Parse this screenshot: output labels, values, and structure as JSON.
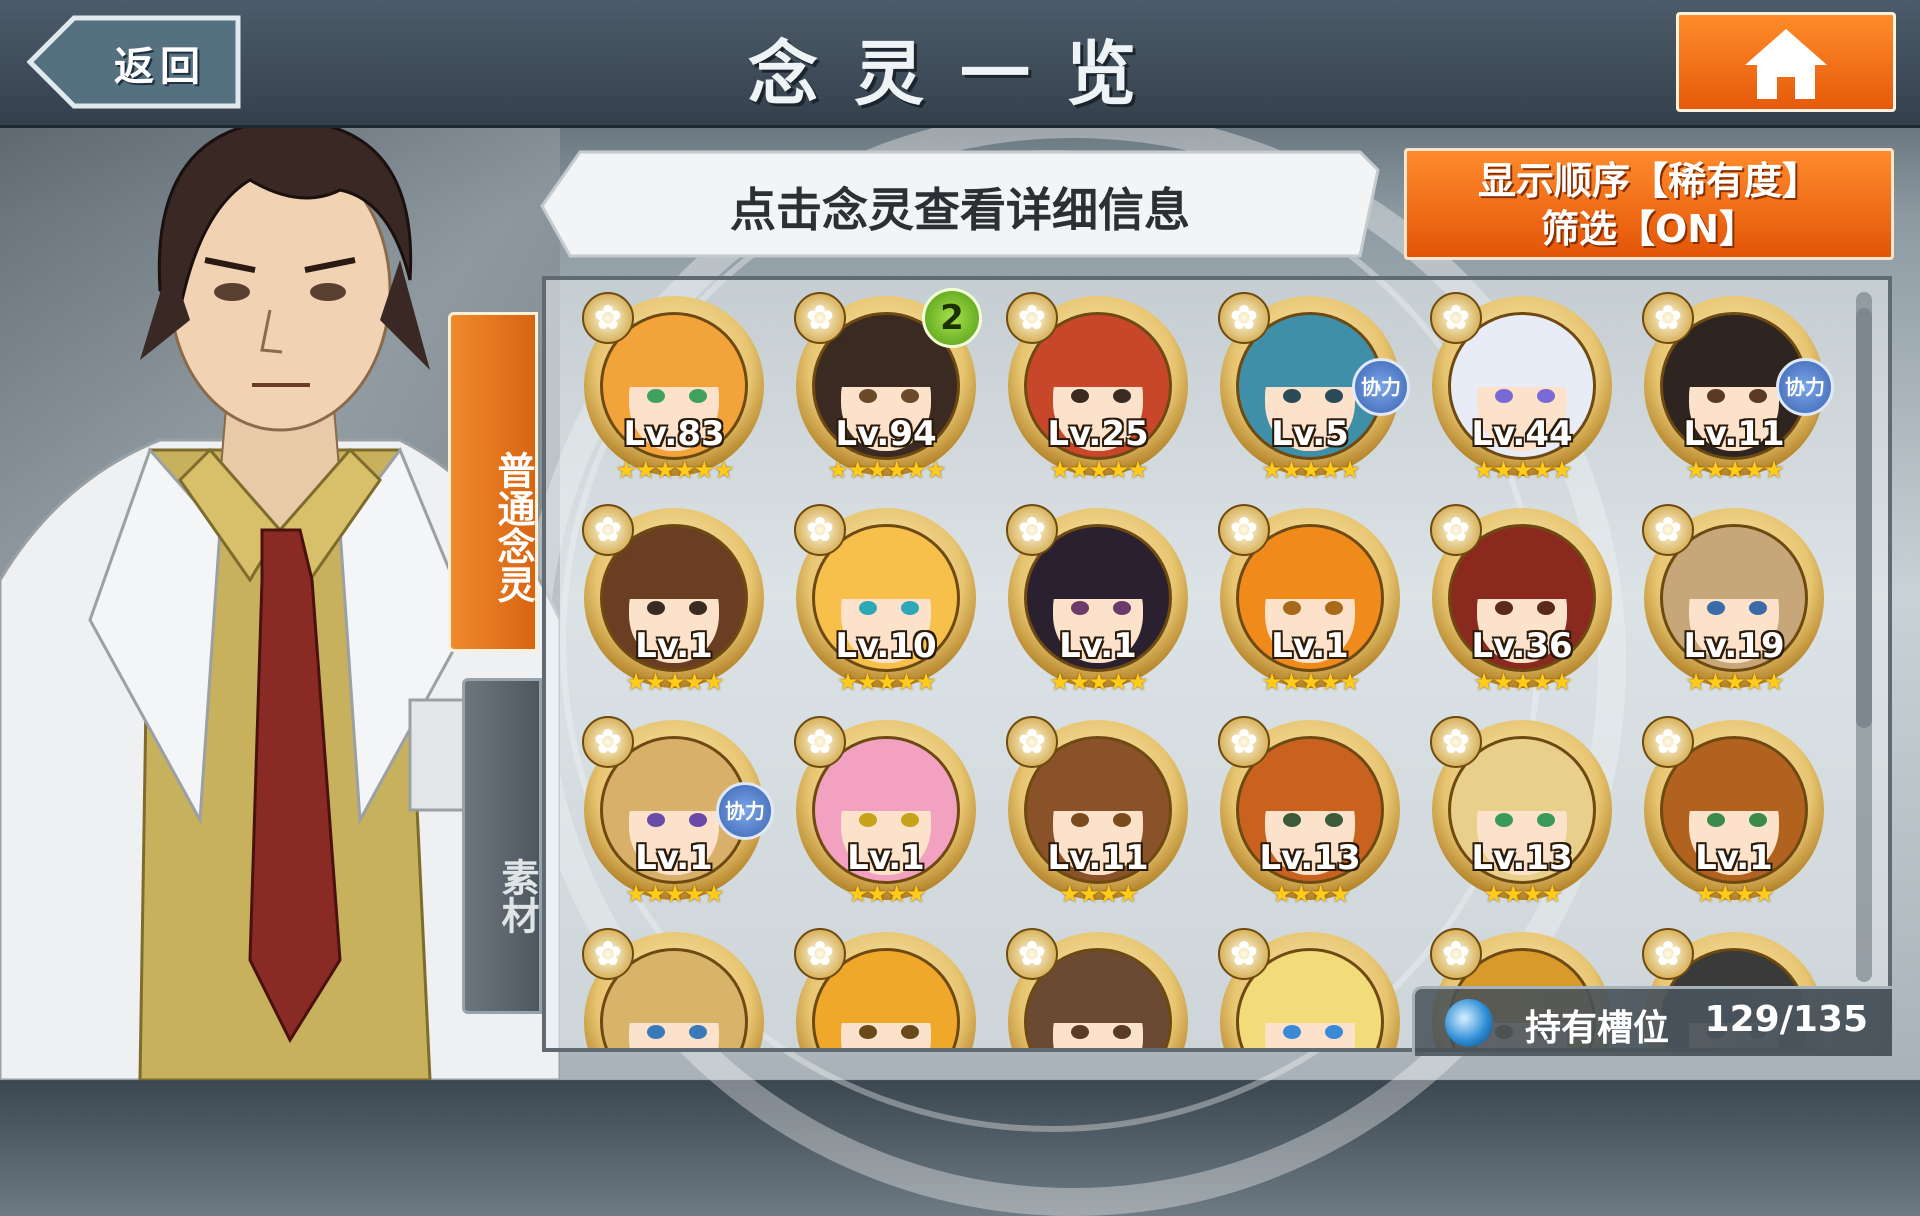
{
  "header": {
    "back_label": "返回",
    "title": "念灵一览"
  },
  "instruction": "点击念灵查看详细信息",
  "sort_button": {
    "line1": "显示顺序【稀有度】",
    "line2": "筛选【ON】"
  },
  "tabs": {
    "normal": "普通念灵",
    "material": "素材"
  },
  "assist_label": "协力",
  "slots": {
    "label": "持有槽位",
    "value": "129/135"
  },
  "colors": {
    "accent_orange": "#e85f0c",
    "star_gold": "#ffcc1a",
    "assist_blue": "#3c64b2",
    "badge_green": "#4f9a16"
  },
  "cards": [
    {
      "level": "Lv.83",
      "stars": "★★★★★★",
      "hair": "#f2a33a",
      "eye": "#3fa25c",
      "assist": false,
      "badge": ""
    },
    {
      "level": "Lv.94",
      "stars": "★★★★★★",
      "hair": "#3a2a22",
      "eye": "#6b4a2a",
      "assist": false,
      "badge": "2"
    },
    {
      "level": "Lv.25",
      "stars": "★★★★★",
      "hair": "#c8462a",
      "eye": "#3a2a22",
      "assist": false,
      "badge": ""
    },
    {
      "level": "Lv.5",
      "stars": "★★★★★",
      "hair": "#3f8fa8",
      "eye": "#2a4a5a",
      "assist": true,
      "badge": ""
    },
    {
      "level": "Lv.44",
      "stars": "★★★★★",
      "hair": "#e8ecf7",
      "eye": "#7a6ad8",
      "assist": false,
      "badge": ""
    },
    {
      "level": "Lv.11",
      "stars": "★★★★★",
      "hair": "#2e2420",
      "eye": "#5a3a22",
      "assist": true,
      "badge": ""
    },
    {
      "level": "Lv.1",
      "stars": "★★★★★",
      "hair": "#6a3e22",
      "eye": "#3a2a22",
      "assist": false,
      "badge": ""
    },
    {
      "level": "Lv.10",
      "stars": "★★★★★",
      "hair": "#f6c04a",
      "eye": "#2ea7b8",
      "assist": false,
      "badge": ""
    },
    {
      "level": "Lv.1",
      "stars": "★★★★★",
      "hair": "#2a2030",
      "eye": "#6a3a6a",
      "assist": false,
      "badge": ""
    },
    {
      "level": "Lv.1",
      "stars": "★★★★★",
      "hair": "#f08a1a",
      "eye": "#a86a1a",
      "assist": false,
      "badge": ""
    },
    {
      "level": "Lv.36",
      "stars": "★★★★★",
      "hair": "#8a2a1e",
      "eye": "#5a2a1a",
      "assist": false,
      "badge": ""
    },
    {
      "level": "Lv.19",
      "stars": "★★★★★",
      "hair": "#c7a77a",
      "eye": "#3a6aa8",
      "assist": false,
      "badge": ""
    },
    {
      "level": "Lv.1",
      "stars": "★★★★★",
      "hair": "#d9b06a",
      "eye": "#6a4aa8",
      "assist": true,
      "badge": ""
    },
    {
      "level": "Lv.1",
      "stars": "★★★★",
      "hair": "#f2a2c0",
      "eye": "#c8a21a",
      "assist": false,
      "badge": ""
    },
    {
      "level": "Lv.11",
      "stars": "★★★★",
      "hair": "#8a5228",
      "eye": "#7a4a1a",
      "assist": false,
      "badge": ""
    },
    {
      "level": "Lv.13",
      "stars": "★★★★",
      "hair": "#c8621e",
      "eye": "#3a5a3a",
      "assist": false,
      "badge": ""
    },
    {
      "level": "Lv.13",
      "stars": "★★★★",
      "hair": "#e8d08a",
      "eye": "#3a9a5a",
      "assist": false,
      "badge": ""
    },
    {
      "level": "Lv.1",
      "stars": "★★★★",
      "hair": "#b0621e",
      "eye": "#3a8a4a",
      "assist": false,
      "badge": ""
    },
    {
      "level": "",
      "stars": "",
      "hair": "#d8b46a",
      "eye": "#3a7ab8",
      "assist": false,
      "badge": ""
    },
    {
      "level": "",
      "stars": "",
      "hair": "#f0a82a",
      "eye": "#6a4a1a",
      "assist": false,
      "badge": ""
    },
    {
      "level": "",
      "stars": "",
      "hair": "#6a4a32",
      "eye": "#5a3a22",
      "assist": false,
      "badge": ""
    },
    {
      "level": "",
      "stars": "",
      "hair": "#f2dc7a",
      "eye": "#3a8ad8",
      "assist": false,
      "badge": ""
    },
    {
      "level": "",
      "stars": "",
      "hair": "#d89a2a",
      "eye": "#6a4a1a",
      "assist": false,
      "badge": ""
    },
    {
      "level": "",
      "stars": "",
      "hair": "#3a3a3a",
      "eye": "#3a3a3a",
      "assist": false,
      "badge": ""
    }
  ]
}
